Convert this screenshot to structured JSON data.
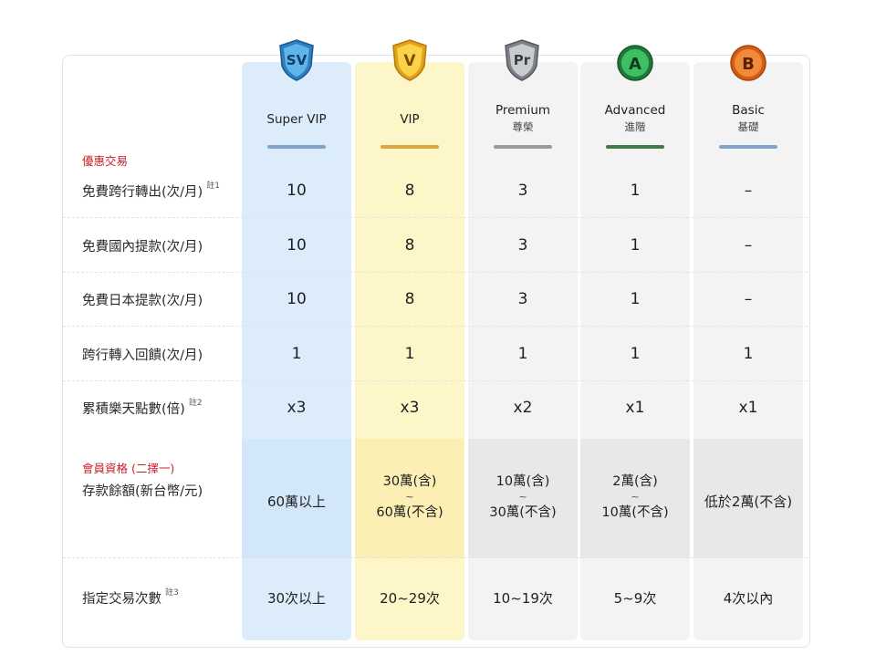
{
  "tiers": [
    {
      "badge": "SV",
      "name": "Super VIP",
      "sub": "",
      "bar_color": "#7fa6c8",
      "badge_color": "#3a8fc9"
    },
    {
      "badge": "V",
      "name": "VIP",
      "sub": "",
      "bar_color": "#e0a53b",
      "badge_color": "#f2b51c"
    },
    {
      "badge": "Pr",
      "name": "Premium",
      "sub": "尊榮",
      "bar_color": "#9a9a9a",
      "badge_color": "#8c9096"
    },
    {
      "badge": "A",
      "name": "Advanced",
      "sub": "進階",
      "bar_color": "#3e7a4a",
      "badge_color": "#2e9e4e"
    },
    {
      "badge": "B",
      "name": "Basic",
      "sub": "基礎",
      "bar_color": "#7fa6c8",
      "badge_color": "#ec7a2d"
    }
  ],
  "section1": "優惠交易",
  "section2": "會員資格 (二擇一)",
  "rows": [
    {
      "label": "免費跨行轉出(次/月)",
      "note": "註1",
      "values": [
        "10",
        "8",
        "3",
        "1",
        "–"
      ]
    },
    {
      "label": "免費國內提款(次/月)",
      "note": "",
      "values": [
        "10",
        "8",
        "3",
        "1",
        "–"
      ]
    },
    {
      "label": "免費日本提款(次/月)",
      "note": "",
      "values": [
        "10",
        "8",
        "3",
        "1",
        "–"
      ]
    },
    {
      "label": "跨行轉入回饋(次/月)",
      "note": "",
      "values": [
        "1",
        "1",
        "1",
        "1",
        "1"
      ]
    },
    {
      "label": "累積樂天點數(倍)",
      "note": "註2",
      "values": [
        "x3",
        "x3",
        "x2",
        "x1",
        "x1"
      ]
    }
  ],
  "deposit": {
    "label": "存款餘額(新台幣/元)",
    "tilde": "~",
    "values": [
      {
        "top": "60萬以上",
        "bottom": ""
      },
      {
        "top": "30萬(含)",
        "bottom": "60萬(不含)"
      },
      {
        "top": "10萬(含)",
        "bottom": "30萬(不含)"
      },
      {
        "top": "2萬(含)",
        "bottom": "10萬(不含)"
      },
      {
        "top": "低於2萬(不含)",
        "bottom": ""
      }
    ]
  },
  "transactions": {
    "label": "指定交易次數",
    "note": "註3",
    "values": [
      "30次以上",
      "20~29次",
      "10~19次",
      "5~9次",
      "4次以內"
    ]
  }
}
